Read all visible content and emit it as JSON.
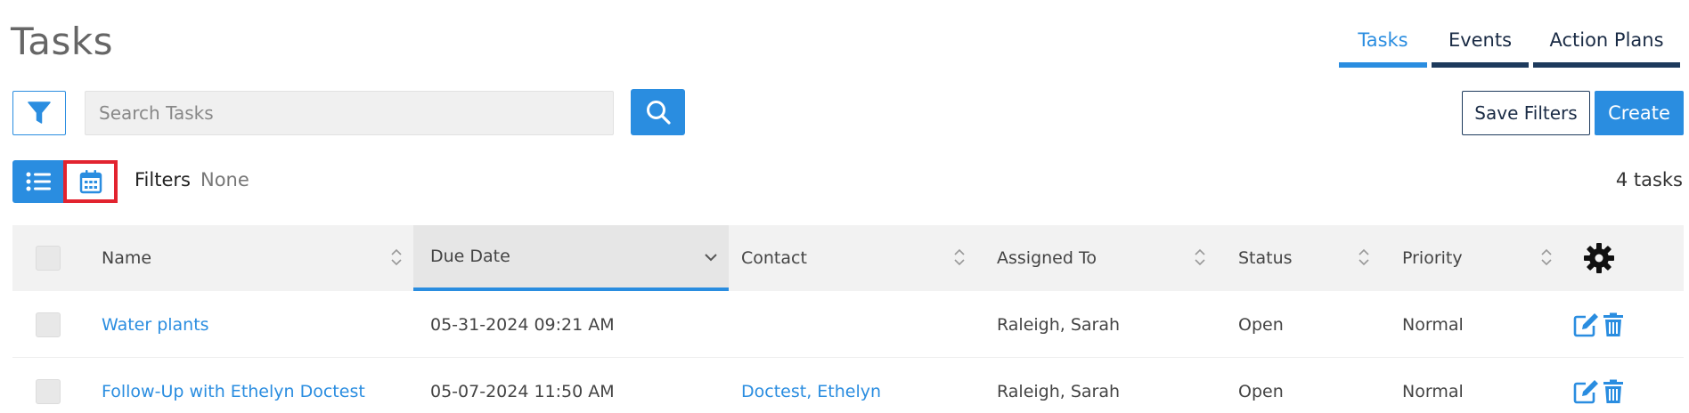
{
  "page": {
    "title": "Tasks"
  },
  "tabs": [
    {
      "label": "Tasks",
      "active": true
    },
    {
      "label": "Events",
      "active": false
    },
    {
      "label": "Action Plans",
      "active": false
    }
  ],
  "toolbar": {
    "search_placeholder": "Search Tasks",
    "save_filters_label": "Save Filters",
    "create_label": "Create"
  },
  "filters": {
    "label": "Filters",
    "value": "None"
  },
  "task_count": "4 tasks",
  "table": {
    "columns": {
      "name": "Name",
      "due_date": "Due Date",
      "contact": "Contact",
      "assigned_to": "Assigned To",
      "status": "Status",
      "priority": "Priority"
    },
    "sorted_column": "Due Date",
    "sort_direction": "descending",
    "rows": [
      {
        "name": "Water plants",
        "due_date": "05-31-2024 09:21 AM",
        "contact": "",
        "assigned_to": "Raleigh, Sarah",
        "status": "Open",
        "priority": "Normal"
      },
      {
        "name": "Follow-Up with Ethelyn Doctest",
        "due_date": "05-07-2024 11:50 AM",
        "contact": "Doctest, Ethelyn",
        "assigned_to": "Raleigh, Sarah",
        "status": "Open",
        "priority": "Normal"
      }
    ]
  },
  "icons": {
    "filter": "filter-icon",
    "search": "search-icon",
    "list_view": "list-icon",
    "calendar_view": "calendar-icon",
    "settings": "gear-icon",
    "edit": "edit-icon",
    "delete": "trash-icon",
    "sort": "sort-icon",
    "sort_desc": "chevron-down-icon"
  },
  "colors": {
    "accent": "#2a8de0",
    "navy": "#1d3a5c",
    "highlight_border": "#e2232f",
    "header_bg": "#f2f2f2"
  }
}
